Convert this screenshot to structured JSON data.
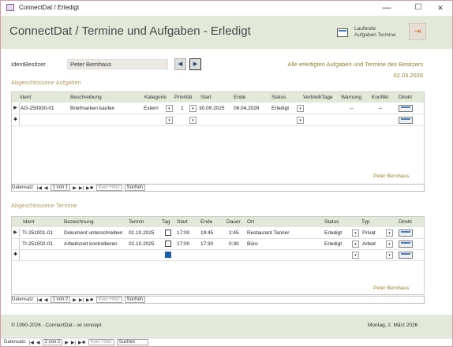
{
  "window": {
    "title": "ConnectDat / Erledigt",
    "minimize": "—",
    "maximize": "☐",
    "close": "✕"
  },
  "header": {
    "title": "ConnectDat / Termine und Aufgaben - Erledigt",
    "laufende_button": "Laufende\nAufgaben Termine",
    "exit_icon": "exit-icon"
  },
  "owner": {
    "label": "IdentBesitzer",
    "value": "Peter Bernhaus",
    "prev": "◀",
    "next": "▶"
  },
  "info": {
    "text": "Alle erledigten Aufgaben und Termine des Besitzers",
    "date": "02.03.2026"
  },
  "tasks": {
    "section_title": "Abgeschlossene  Aufgaben",
    "columns": [
      "Ident",
      "Beschreibung",
      "Kategorie",
      "Priorität",
      "Start",
      "Ende",
      "Status",
      "VerbleibTage",
      "Warnung",
      "Konflikt",
      "Direkt"
    ],
    "rows": [
      {
        "ident": "AG-250930-01",
        "beschreibung": "Briefmarken kaufen",
        "kategorie": "Extern",
        "prioritaet": "1",
        "start": "30.09.2025",
        "ende": "06.04.2026",
        "status": "Erledigt",
        "warnung": "--",
        "konflikt": "--"
      }
    ],
    "new_row_marker": "✱",
    "owner_footer": "Peter Bernhaus",
    "recnav": {
      "label": "Datensatz:",
      "position": "1 von 1",
      "filter": "Kein Filter",
      "search": "Suchen",
      "first": "|◀",
      "prev": "◀",
      "next": "▶",
      "last": "▶|",
      "new": "▶✱"
    }
  },
  "appointments": {
    "section_title": "Abgeschlossene Termine",
    "columns": [
      "Ident",
      "Bezeichnung",
      "Termin",
      "Tag",
      "Start",
      "Ende",
      "Dauer",
      "Ort",
      "Status",
      "Typ",
      "Direkt"
    ],
    "rows": [
      {
        "ident": "TI-251001-01",
        "bezeichnung": "Dokument unterschreiben",
        "termin": "01.10.2025",
        "start": "17:00",
        "ende": "19:45",
        "dauer": "2:45",
        "ort": "Restaurant Tanner",
        "status": "Erledigt",
        "typ": "Privat"
      },
      {
        "ident": "TI-251002-01",
        "bezeichnung": "Arbeitszeit kontrollieren",
        "termin": "02.10.2025",
        "start": "17:00",
        "ende": "17:30",
        "dauer": "0:30",
        "ort": "Büro",
        "status": "Erledigt",
        "typ": "Arbeit"
      }
    ],
    "new_row_marker": "✱",
    "owner_footer": "Peter Bernhaus",
    "recnav": {
      "label": "Datensatz:",
      "position": "1 von 2",
      "filter": "Kein Filter",
      "search": "Suchen",
      "first": "|◀",
      "prev": "◀",
      "next": "▶",
      "last": "▶|",
      "new": "▶✱"
    }
  },
  "footer": {
    "left": "© 1990-2026 - ConnectDat - wi concept",
    "right": "Montag, 2. März 2026"
  },
  "main_recnav": {
    "label": "Datensatz:",
    "position": "2 von 2",
    "filter": "Kein Filter",
    "search": "Suchen",
    "first": "|◀",
    "prev": "◀",
    "next": "▶",
    "last": "▶|",
    "new": "▶✱"
  },
  "colors": {
    "header_bg": "#e2e9d8",
    "accent_gold": "#9a7d2e",
    "section_text": "#b49a5e"
  }
}
